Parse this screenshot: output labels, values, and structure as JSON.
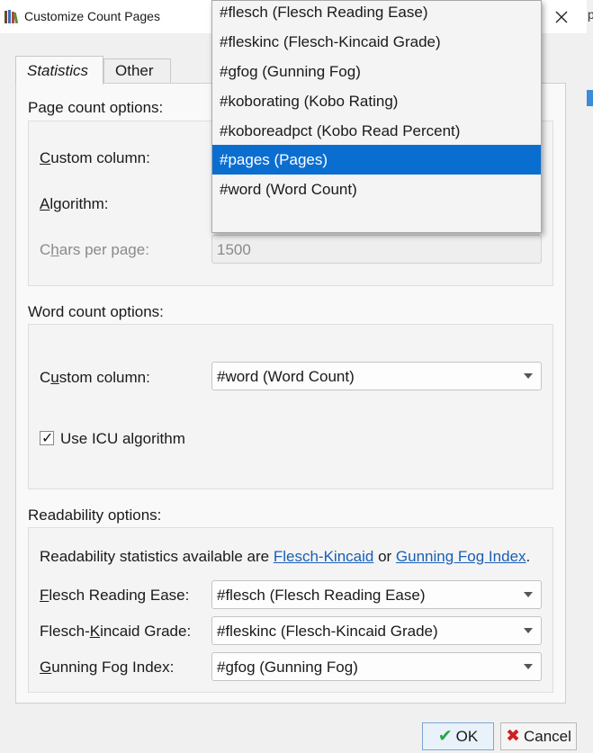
{
  "window": {
    "title": "Customize Count Pages",
    "right_peek": "p"
  },
  "tabs": {
    "statistics": "Statistics",
    "other": "Other"
  },
  "page_count": {
    "title": "Page count options:",
    "custom_column_label_pre": "C",
    "custom_column_label_post": "ustom column:",
    "algorithm_label_pre": "A",
    "algorithm_label_post": "lgorithm:",
    "chars_label_pre": "C",
    "chars_label_mid": "h",
    "chars_label_post": "ars per page:",
    "chars_value": "1500"
  },
  "dropdown": {
    "items": [
      "#flesch (Flesch Reading Ease)",
      "#fleskinc (Flesch-Kincaid Grade)",
      "#gfog (Gunning Fog)",
      "#koborating (Kobo Rating)",
      "#koboreadpct (Kobo Read Percent)",
      "#pages (Pages)",
      "#word (Word Count)"
    ],
    "selected_index": 5
  },
  "word_count": {
    "title": "Word count options:",
    "custom_column_label_pre": "C",
    "custom_column_label_mid": "u",
    "custom_column_label_post": "stom column:",
    "custom_column_value": "#word (Word Count)",
    "icu_label": "Use ICU algorithm",
    "icu_checked": true
  },
  "readability": {
    "title": "Readability options:",
    "intro_pre": "Readability statistics available are ",
    "link1": "Flesch-Kincaid",
    "intro_mid": " or ",
    "link2": "Gunning Fog Index",
    "intro_post": ".",
    "flesch_label_pre": "F",
    "flesch_label_post": "lesch Reading Ease:",
    "flesch_value": "#flesch (Flesch Reading Ease)",
    "kincaid_label_pre": "Flesch-",
    "kincaid_label_mid": "K",
    "kincaid_label_post": "incaid Grade:",
    "kincaid_value": "#fleskinc (Flesch-Kincaid Grade)",
    "fog_label_pre": "G",
    "fog_label_post": "unning Fog Index:",
    "fog_value": "#gfog (Gunning Fog)"
  },
  "buttons": {
    "ok": "OK",
    "cancel": "Cancel"
  },
  "colors": {
    "selection": "#0a6ed1",
    "link": "#1a5fb4",
    "ok_icon": "#2da44e",
    "cancel_icon": "#d21f1f"
  }
}
